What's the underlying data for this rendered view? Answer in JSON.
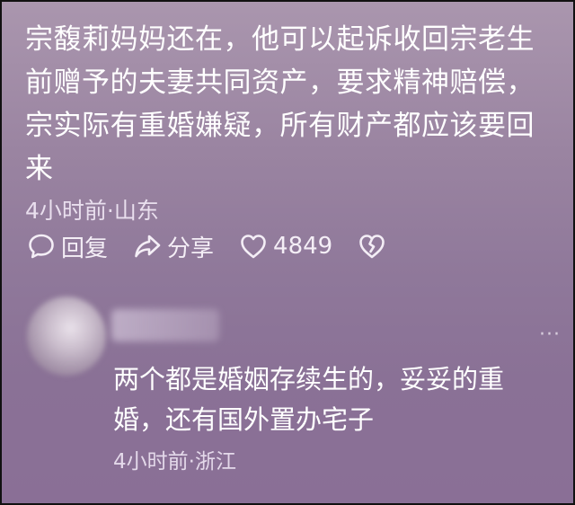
{
  "main_comment": {
    "text": "宗馥莉妈妈还在，他可以起诉收回宗老生前赠予的夫妻共同资产，要求精神赔偿，宗实际有重婚嫌疑，所有财产都应该要回来",
    "meta": "4小时前·山东"
  },
  "actions": {
    "reply_label": "回复",
    "share_label": "分享",
    "like_count": "4849",
    "reply_icon": "speech-bubble-icon",
    "share_icon": "share-arrow-icon",
    "like_icon": "heart-icon",
    "dislike_icon": "broken-heart-icon"
  },
  "reply": {
    "avatar_icon": "avatar",
    "more_label": "···",
    "text": "两个都是婚姻存续生的，妥妥的重婚，还有国外置办宅子",
    "meta": "4小时前·浙江"
  },
  "colors": {
    "background_top": "#aa96ae",
    "background_bottom": "#8a6f96",
    "text": "#ffffff",
    "meta": "#e9dfee"
  }
}
